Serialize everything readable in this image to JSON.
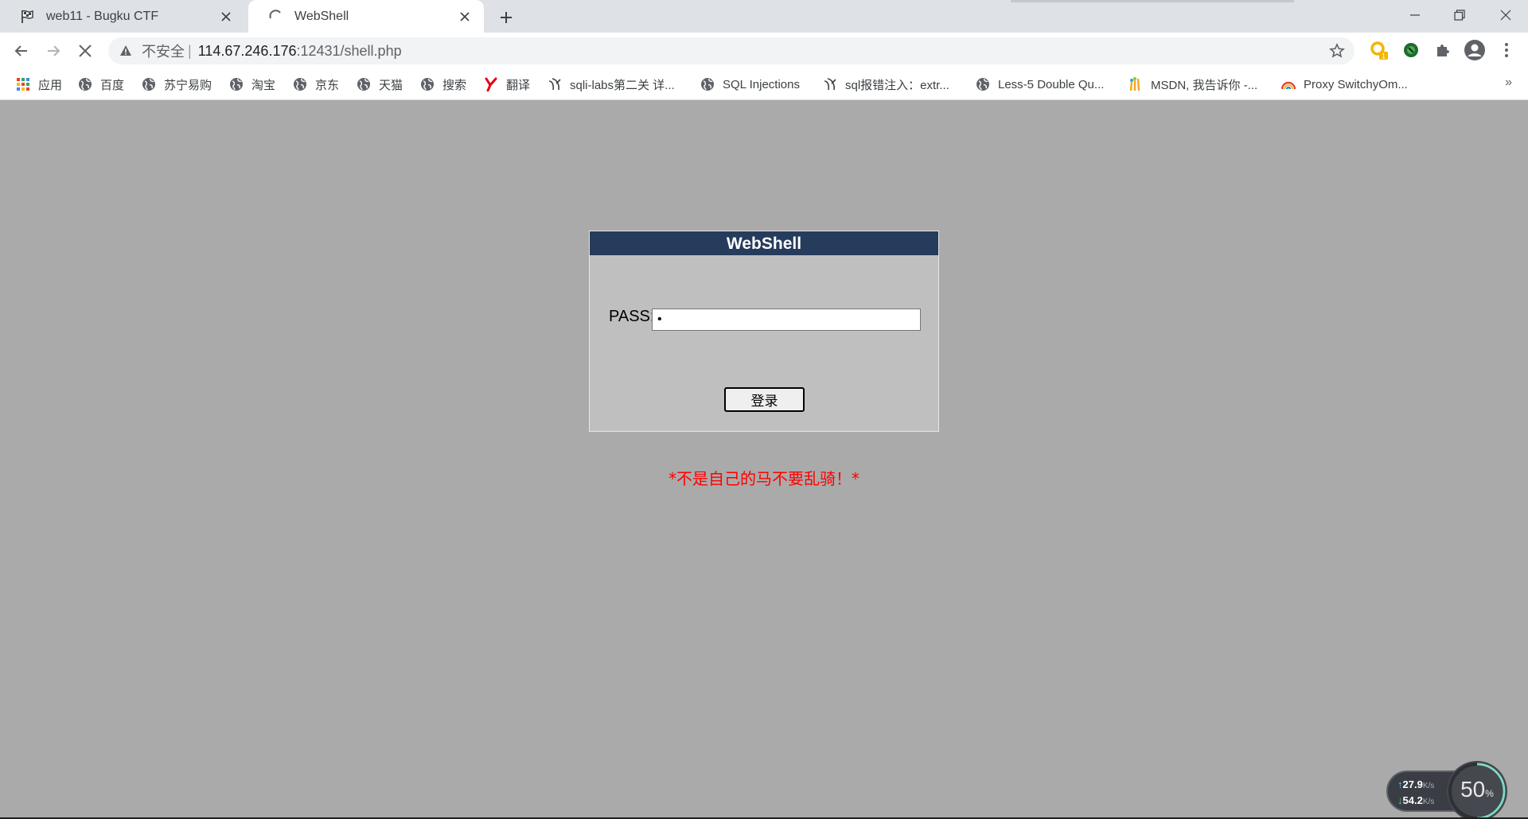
{
  "tabs": [
    {
      "title": "web11 - Bugku CTF",
      "icon": "flag-icon",
      "active": false
    },
    {
      "title": "WebShell",
      "icon": "loading-spinner-icon",
      "active": true
    }
  ],
  "toolbar": {
    "insecure_label": "不安全",
    "separator": "|",
    "url_host": "114.67.246.176",
    "url_rest": ":12431/shell.php"
  },
  "bookmarks": [
    {
      "label": "应用",
      "icon": "apps-grid-icon"
    },
    {
      "label": "百度",
      "icon": "globe-icon"
    },
    {
      "label": "苏宁易购",
      "icon": "globe-icon"
    },
    {
      "label": "淘宝",
      "icon": "globe-icon"
    },
    {
      "label": "京东",
      "icon": "globe-icon"
    },
    {
      "label": "天猫",
      "icon": "globe-icon"
    },
    {
      "label": "搜索",
      "icon": "globe-icon"
    },
    {
      "label": "翻译",
      "icon": "youdao-icon"
    },
    {
      "label": "sqli-labs第二关 详...",
      "icon": "cnblogs-icon"
    },
    {
      "label": "SQL Injections",
      "icon": "globe-icon"
    },
    {
      "label": "sql报错注入：extr...",
      "icon": "cnblogs-icon"
    },
    {
      "label": "Less-5 Double Qu...",
      "icon": "globe-icon"
    },
    {
      "label": "MSDN, 我告诉你 -...",
      "icon": "msdn-icon"
    },
    {
      "label": "Proxy SwitchyOm...",
      "icon": "rainbow-icon"
    }
  ],
  "bookmarks_more": "»",
  "login": {
    "header": "WebShell",
    "pass_label": "PASS:",
    "pass_value": "•",
    "button_label": "登录"
  },
  "warning": "*不是自己的马不要乱骑！*",
  "speed_widget": {
    "upload": "27.9",
    "upload_unit": "K/s",
    "download": "54.2",
    "download_unit": "K/s",
    "percent": "50",
    "percent_sign": "%",
    "percent_value": 50
  },
  "colors": {
    "page_bg": "#aaaaaa",
    "login_header_bg": "#263c5c",
    "login_box_bg": "#bfbfbf",
    "warning_text": "#ff0000"
  }
}
